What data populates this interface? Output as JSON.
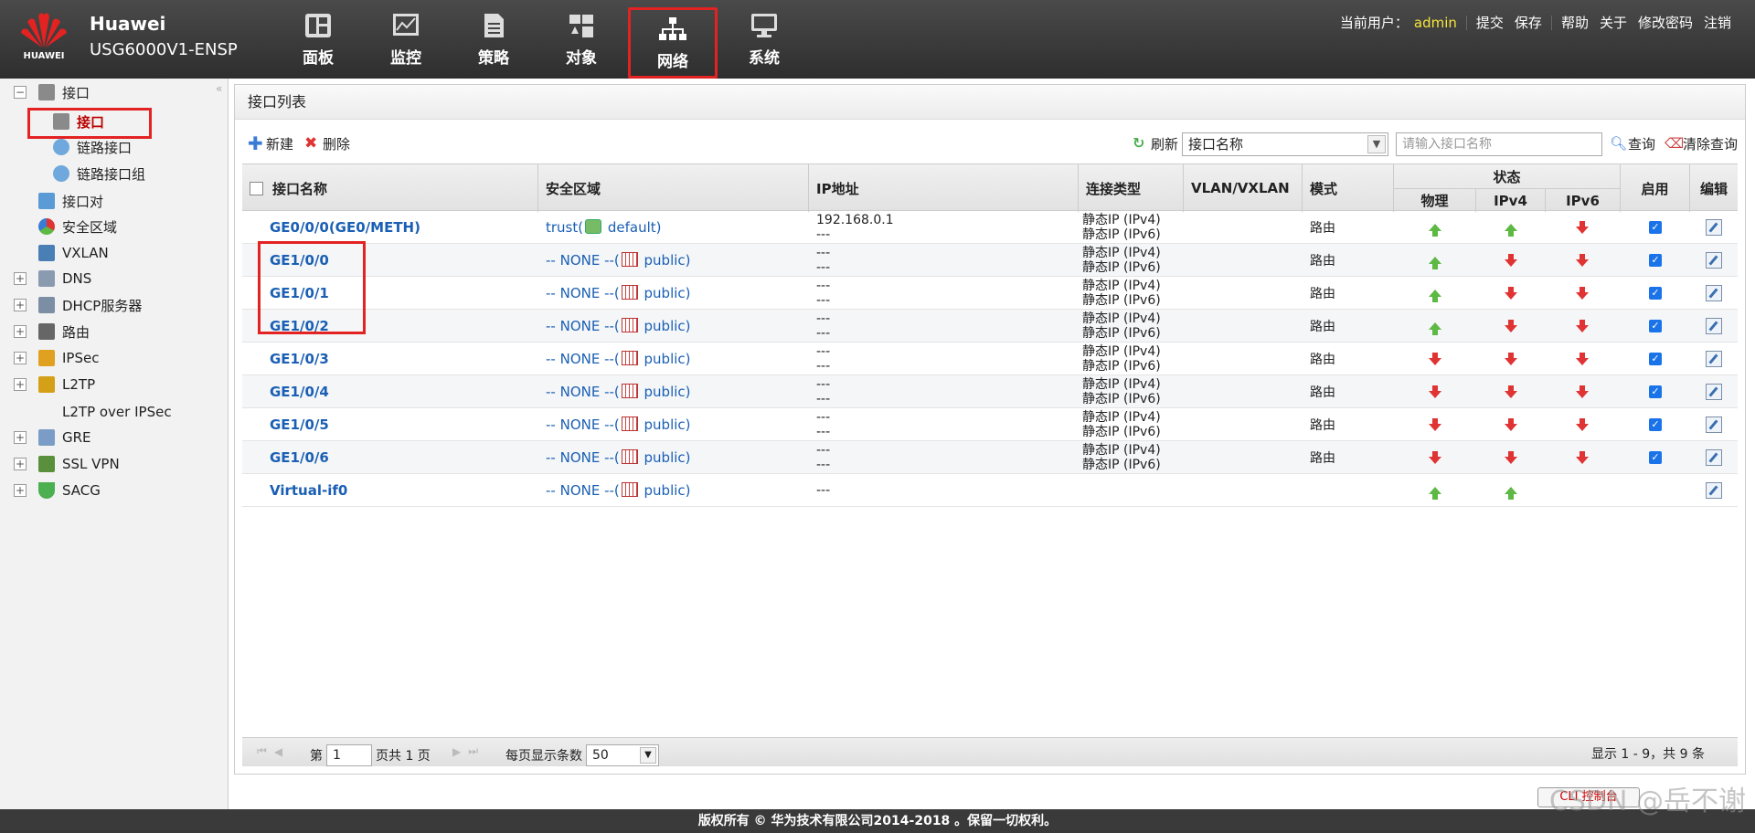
{
  "header": {
    "logo_text": "HUAWEI",
    "brand_line1": "Huawei",
    "brand_line2": "USG6000V1-ENSP",
    "nav": [
      {
        "label": "面板",
        "icon": "dashboard-icon"
      },
      {
        "label": "监控",
        "icon": "monitor-icon"
      },
      {
        "label": "策略",
        "icon": "policy-icon"
      },
      {
        "label": "对象",
        "icon": "object-icon"
      },
      {
        "label": "网络",
        "icon": "network-icon",
        "active": true
      },
      {
        "label": "系统",
        "icon": "system-icon"
      }
    ],
    "current_user_label": "当前用户：",
    "current_user": "admin",
    "links": [
      "提交",
      "保存",
      "帮助",
      "关于",
      "修改密码",
      "注销"
    ]
  },
  "sidebar": {
    "items": [
      {
        "label": "接口",
        "expander": "−"
      },
      {
        "label": "接口",
        "selected": true
      },
      {
        "label": "链路接口"
      },
      {
        "label": "链路接口组"
      },
      {
        "label": "接口对"
      },
      {
        "label": "安全区域"
      },
      {
        "label": "VXLAN"
      },
      {
        "label": "DNS",
        "expander": "+"
      },
      {
        "label": "DHCP服务器",
        "expander": "+"
      },
      {
        "label": "路由",
        "expander": "+"
      },
      {
        "label": "IPSec",
        "expander": "+"
      },
      {
        "label": "L2TP",
        "expander": "+"
      },
      {
        "label": "L2TP over IPSec"
      },
      {
        "label": "GRE",
        "expander": "+"
      },
      {
        "label": "SSL VPN",
        "expander": "+"
      },
      {
        "label": "SACG",
        "expander": "+"
      }
    ]
  },
  "panel": {
    "title": "接口列表",
    "toolbar": {
      "new_label": "新建",
      "delete_label": "删除",
      "refresh_label": "刷新",
      "filter_select": "接口名称",
      "search_placeholder": "请输入接口名称",
      "query_label": "查询",
      "clear_label": "清除查询"
    }
  },
  "table": {
    "headers": {
      "name": "接口名称",
      "zone": "安全区域",
      "ip": "IP地址",
      "conn_type": "连接类型",
      "vlan": "VLAN/VXLAN",
      "mode": "模式",
      "status": "状态",
      "physical": "物理",
      "ipv4": "IPv4",
      "ipv6": "IPv6",
      "enable": "启用",
      "edit": "编辑"
    },
    "rows": [
      {
        "name": "GE0/0/0(GE0/METH)",
        "zone_pre": "trust(",
        "zone_post": " default)",
        "zone_icon": "green",
        "ip1": "192.168.0.1",
        "ip2": "---",
        "conn1": "静态IP (IPv4)",
        "conn2": "静态IP (IPv6)",
        "mode": "路由",
        "phys": "up",
        "v4": "up",
        "v6": "down",
        "enabled": true
      },
      {
        "name": "GE1/0/0",
        "zone_pre": "-- NONE --(",
        "zone_post": " public)",
        "zone_icon": "red",
        "ip1": "---",
        "ip2": "---",
        "conn1": "静态IP (IPv4)",
        "conn2": "静态IP (IPv6)",
        "mode": "路由",
        "phys": "up",
        "v4": "down",
        "v6": "down",
        "enabled": true
      },
      {
        "name": "GE1/0/1",
        "zone_pre": "-- NONE --(",
        "zone_post": " public)",
        "zone_icon": "red",
        "ip1": "---",
        "ip2": "---",
        "conn1": "静态IP (IPv4)",
        "conn2": "静态IP (IPv6)",
        "mode": "路由",
        "phys": "up",
        "v4": "down",
        "v6": "down",
        "enabled": true
      },
      {
        "name": "GE1/0/2",
        "zone_pre": "-- NONE --(",
        "zone_post": " public)",
        "zone_icon": "red",
        "ip1": "---",
        "ip2": "---",
        "conn1": "静态IP (IPv4)",
        "conn2": "静态IP (IPv6)",
        "mode": "路由",
        "phys": "up",
        "v4": "down",
        "v6": "down",
        "enabled": true
      },
      {
        "name": "GE1/0/3",
        "zone_pre": "-- NONE --(",
        "zone_post": " public)",
        "zone_icon": "red",
        "ip1": "---",
        "ip2": "---",
        "conn1": "静态IP (IPv4)",
        "conn2": "静态IP (IPv6)",
        "mode": "路由",
        "phys": "down",
        "v4": "down",
        "v6": "down",
        "enabled": true
      },
      {
        "name": "GE1/0/4",
        "zone_pre": "-- NONE --(",
        "zone_post": " public)",
        "zone_icon": "red",
        "ip1": "---",
        "ip2": "---",
        "conn1": "静态IP (IPv4)",
        "conn2": "静态IP (IPv6)",
        "mode": "路由",
        "phys": "down",
        "v4": "down",
        "v6": "down",
        "enabled": true
      },
      {
        "name": "GE1/0/5",
        "zone_pre": "-- NONE --(",
        "zone_post": " public)",
        "zone_icon": "red",
        "ip1": "---",
        "ip2": "---",
        "conn1": "静态IP (IPv4)",
        "conn2": "静态IP (IPv6)",
        "mode": "路由",
        "phys": "down",
        "v4": "down",
        "v6": "down",
        "enabled": true
      },
      {
        "name": "GE1/0/6",
        "zone_pre": "-- NONE --(",
        "zone_post": " public)",
        "zone_icon": "red",
        "ip1": "---",
        "ip2": "---",
        "conn1": "静态IP (IPv4)",
        "conn2": "静态IP (IPv6)",
        "mode": "路由",
        "phys": "down",
        "v4": "down",
        "v6": "down",
        "enabled": true
      },
      {
        "name": "Virtual-if0",
        "zone_pre": "-- NONE --(",
        "zone_post": " public)",
        "zone_icon": "red",
        "ip1": "---",
        "ip2": "",
        "conn1": "",
        "conn2": "",
        "mode": "",
        "phys": "up",
        "v4": "up",
        "v6": "",
        "enabled": false
      }
    ]
  },
  "pager": {
    "page_label": "第",
    "page_value": "1",
    "total_label": "页共 1 页",
    "per_page_label": "每页显示条数",
    "per_page_value": "50",
    "summary": "显示 1 - 9，共 9 条"
  },
  "footer": {
    "copyright": "版权所有 © 华为技术有限公司2014-2018 。保留一切权利。",
    "console": "CLI 控制台"
  },
  "watermark": "CSDN @岳不谢",
  "colors": {
    "accent_red": "#e32222",
    "link_blue": "#1a5fb4",
    "user_yellow": "#f3e43a",
    "up_green": "#5db844",
    "down_red": "#e03333"
  }
}
